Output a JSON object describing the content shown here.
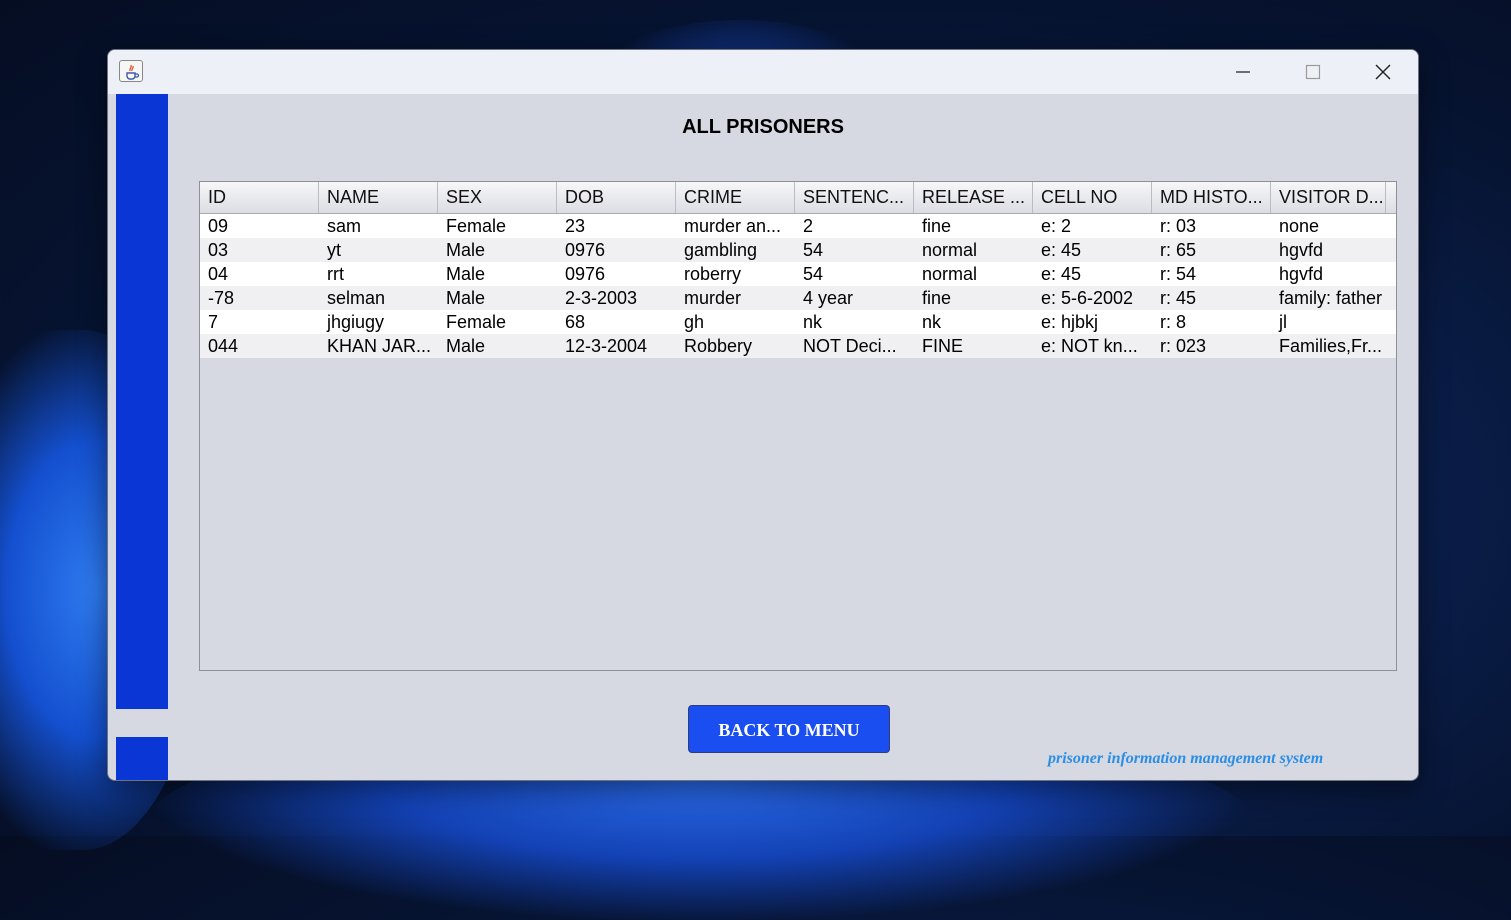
{
  "window": {
    "controls": {
      "minimize": "minimize-icon",
      "maximize": "maximize-icon",
      "close": "close-icon"
    }
  },
  "page": {
    "title": "ALL PRISONERS"
  },
  "table": {
    "headers": [
      "ID",
      "NAME",
      "SEX",
      "DOB",
      "CRIME",
      "SENTENC...",
      "RELEASE ...",
      "CELL NO",
      "MD HISTO...",
      "VISITOR D..."
    ],
    "rows": [
      [
        "09",
        "sam",
        "Female",
        "23",
        "murder an...",
        "2",
        "fine",
        "e: 2",
        "r: 03",
        "none"
      ],
      [
        "03",
        "yt",
        "Male",
        "0976",
        "gambling",
        "54",
        "normal",
        "e: 45",
        "r: 65",
        "hgvfd"
      ],
      [
        "04",
        "rrt",
        "Male",
        "0976",
        "roberry",
        "54",
        "normal",
        "e: 45",
        "r: 54",
        "hgvfd"
      ],
      [
        "-78",
        "selman",
        "Male",
        "2-3-2003",
        "murder",
        "4 year",
        "fine",
        "e: 5-6-2002",
        "r: 45",
        "family: father"
      ],
      [
        "7",
        "jhgiugy",
        "Female",
        "68",
        "gh",
        "nk",
        "nk",
        "e: hjbkj",
        "r: 8",
        "jl"
      ],
      [
        "044",
        "KHAN JAR...",
        "Male",
        "12-3-2004",
        "Robbery",
        "NOT Deci...",
        "FINE",
        "e: NOT kn...",
        "r: 023",
        "Families,Fr..."
      ]
    ]
  },
  "actions": {
    "back_label": "BACK TO MENU"
  },
  "footer": {
    "caption": "prisoner information management system"
  },
  "colors": {
    "accent": "#0a36d6",
    "button": "#1b4ef0",
    "caption": "#2a8ee6"
  }
}
